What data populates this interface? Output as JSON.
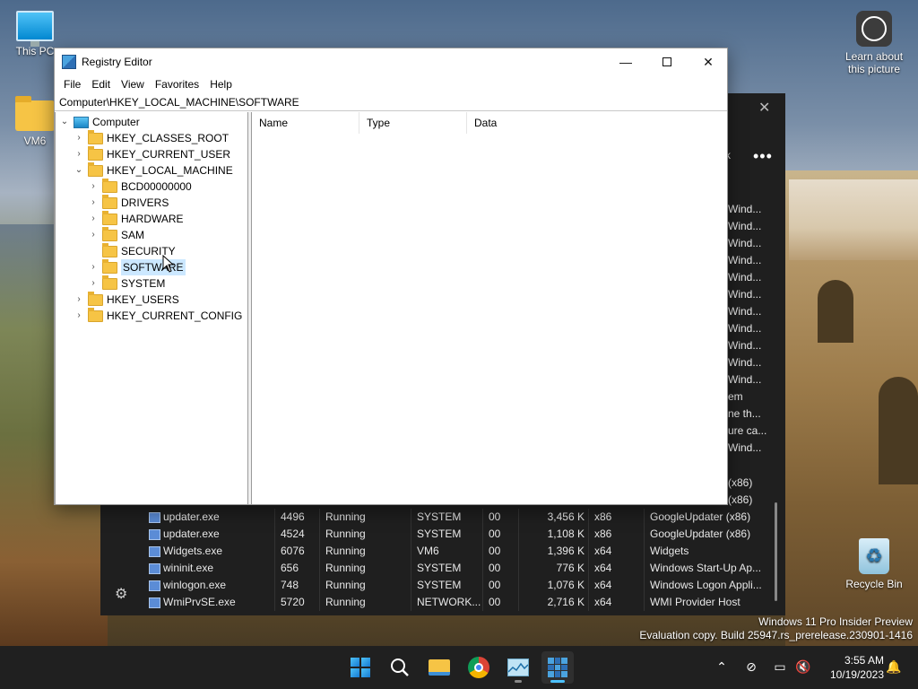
{
  "desktop": {
    "icons": [
      {
        "label": "This PC"
      },
      {
        "label": "VM6"
      },
      {
        "label": "Learn about this picture"
      },
      {
        "label": "Recycle Bin"
      }
    ],
    "watermark": {
      "line1": "Windows 11 Pro Insider Preview",
      "line2": "Evaluation copy. Build 25947.rs_prerelease.230901-1416"
    }
  },
  "regedit": {
    "title": "Registry Editor",
    "menu": [
      "File",
      "Edit",
      "View",
      "Favorites",
      "Help"
    ],
    "address": "Computer\\HKEY_LOCAL_MACHINE\\SOFTWARE",
    "tree": {
      "root": "Computer",
      "hives": [
        "HKEY_CLASSES_ROOT",
        "HKEY_CURRENT_USER",
        "HKEY_LOCAL_MACHINE",
        "HKEY_USERS",
        "HKEY_CURRENT_CONFIG"
      ],
      "hklm_children": [
        "BCD00000000",
        "DRIVERS",
        "HARDWARE",
        "SAM",
        "SECURITY",
        "SOFTWARE",
        "SYSTEM"
      ],
      "selected": "SOFTWARE"
    },
    "list_columns": [
      "Name",
      "Type",
      "Data"
    ]
  },
  "taskmgr": {
    "more_label": "•••",
    "k_label": "k",
    "right_col_text": [
      "Wind...",
      "Wind...",
      "Wind...",
      "Wind...",
      "Wind...",
      "Wind...",
      "Wind...",
      "Wind...",
      "Wind...",
      "Wind...",
      "Wind...",
      "em",
      "ne th...",
      "ure ca...",
      "Wind..."
    ],
    "x86_text": [
      "(x86)",
      "(x86)"
    ],
    "rows": [
      {
        "name": "updater.exe",
        "pid": "4496",
        "status": "Running",
        "user": "SYSTEM",
        "cpu": "00",
        "mem": "3,456 K",
        "arch": "x86",
        "desc": "GoogleUpdater (x86)"
      },
      {
        "name": "updater.exe",
        "pid": "4524",
        "status": "Running",
        "user": "SYSTEM",
        "cpu": "00",
        "mem": "1,108 K",
        "arch": "x86",
        "desc": "GoogleUpdater (x86)"
      },
      {
        "name": "Widgets.exe",
        "pid": "6076",
        "status": "Running",
        "user": "VM6",
        "cpu": "00",
        "mem": "1,396 K",
        "arch": "x64",
        "desc": "Widgets"
      },
      {
        "name": "wininit.exe",
        "pid": "656",
        "status": "Running",
        "user": "SYSTEM",
        "cpu": "00",
        "mem": "776 K",
        "arch": "x64",
        "desc": "Windows Start-Up Ap..."
      },
      {
        "name": "winlogon.exe",
        "pid": "748",
        "status": "Running",
        "user": "SYSTEM",
        "cpu": "00",
        "mem": "1,076 K",
        "arch": "x64",
        "desc": "Windows Logon Appli..."
      },
      {
        "name": "WmiPrvSE.exe",
        "pid": "5720",
        "status": "Running",
        "user": "NETWORK...",
        "cpu": "00",
        "mem": "2,716 K",
        "arch": "x64",
        "desc": "WMI Provider Host"
      }
    ]
  },
  "taskbar": {
    "time": "3:55 AM",
    "date": "10/19/2023",
    "icons": [
      "windows-start-icon",
      "search-icon",
      "file-explorer-icon",
      "chrome-icon",
      "task-manager-icon",
      "registry-editor-icon"
    ]
  }
}
